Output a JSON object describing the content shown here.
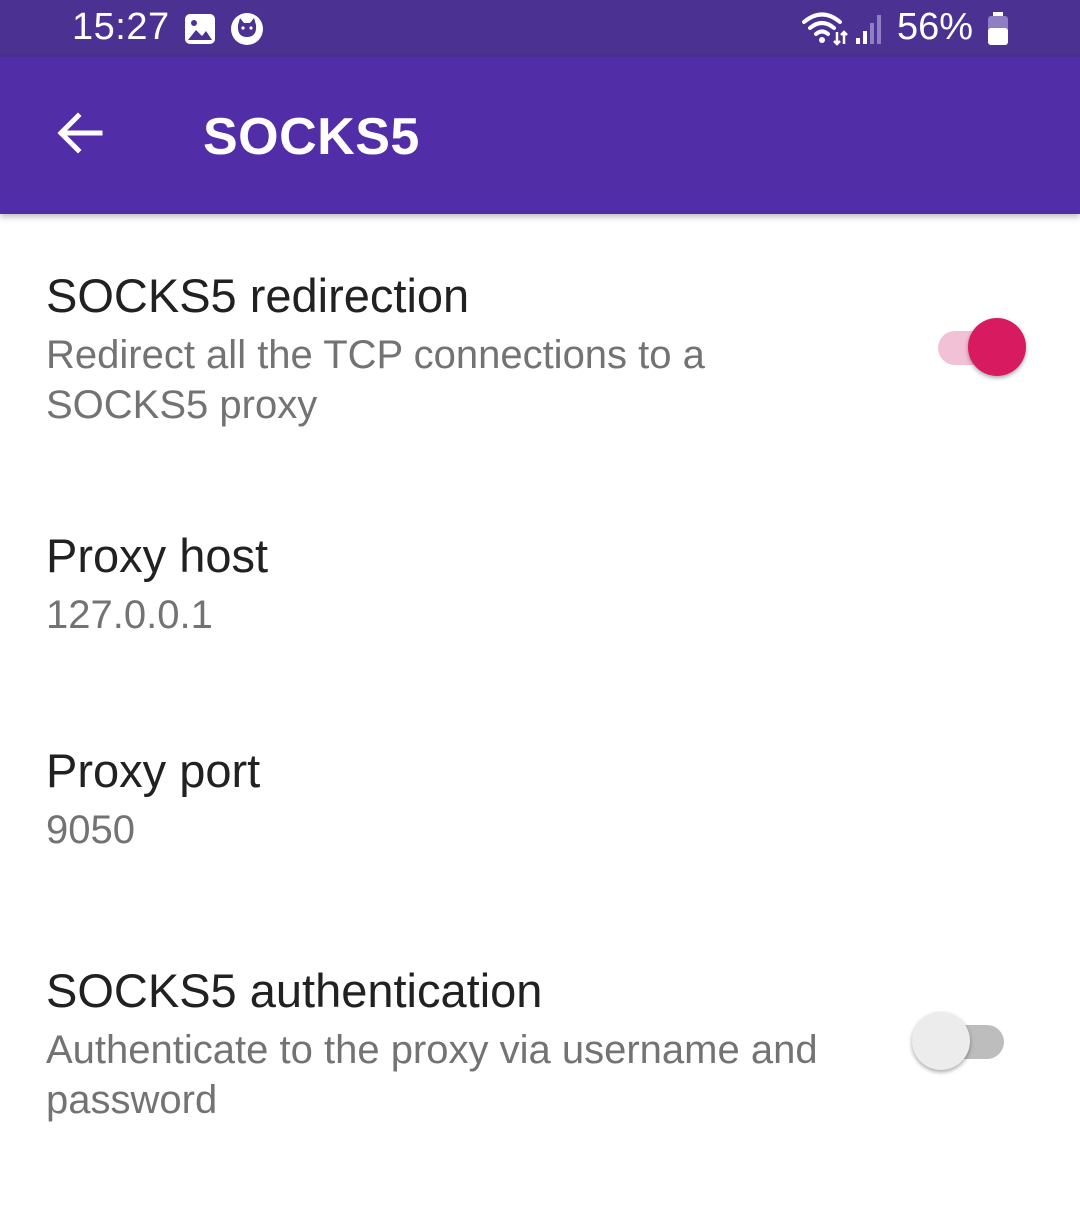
{
  "status_bar": {
    "time": "15:27",
    "battery_percent": "56%",
    "icons": [
      "gallery-notification-icon",
      "cat-notification-icon",
      "wifi-icon",
      "signal-icon",
      "battery-icon"
    ]
  },
  "app_bar": {
    "title": "SOCKS5",
    "back_icon": "arrow-back-icon",
    "color": "#512da8"
  },
  "settings": [
    {
      "title": "SOCKS5 redirection",
      "summary": "Redirect all the TCP connections to a SOCKS5 proxy",
      "toggle": true
    },
    {
      "title": "Proxy host",
      "summary": "127.0.0.1"
    },
    {
      "title": "Proxy port",
      "summary": "9050"
    },
    {
      "title": "SOCKS5 authentication",
      "summary": "Authenticate to the proxy via username and password",
      "toggle": false
    }
  ],
  "colors": {
    "status_bar": "#4a3192",
    "accent": "#d81b60",
    "accent_track": "#f3c1d6",
    "switch_off_thumb": "#ececec",
    "switch_off_track": "#bdbdbd"
  }
}
